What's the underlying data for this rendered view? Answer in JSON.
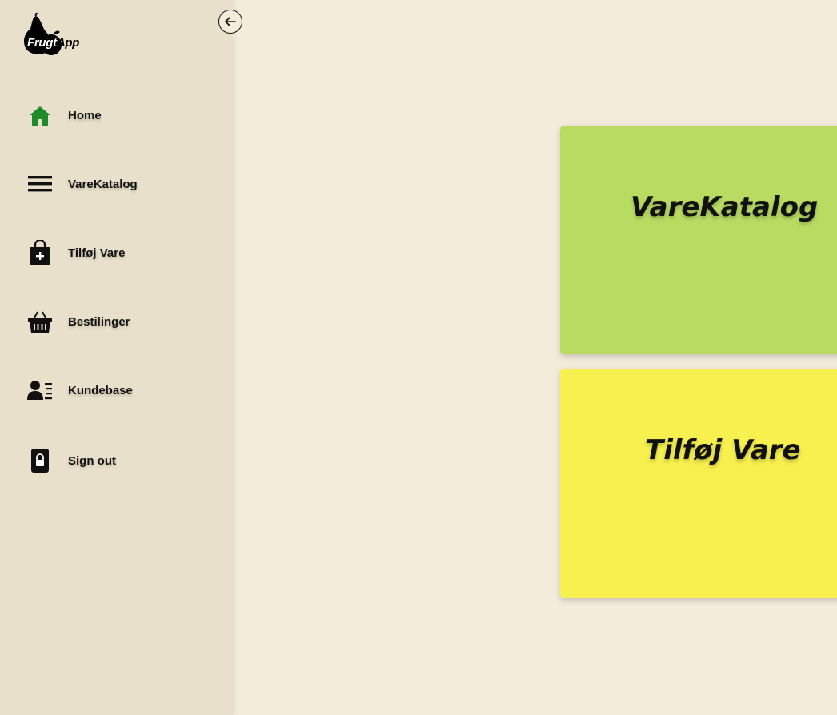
{
  "app": {
    "logo_text_1": "Frugt",
    "logo_text_2": "App"
  },
  "sidebar": {
    "items": [
      {
        "label": "Home",
        "icon": "home-icon"
      },
      {
        "label": "VareKatalog",
        "icon": "menu-lines-icon"
      },
      {
        "label": "Tilføj Vare",
        "icon": "shopping-bag-plus-icon"
      },
      {
        "label": "Bestilinger",
        "icon": "basket-icon"
      },
      {
        "label": "Kundebase",
        "icon": "contact-list-icon"
      },
      {
        "label": "Sign out",
        "icon": "lock-icon"
      }
    ]
  },
  "cards": [
    {
      "title": "VareKatalog"
    },
    {
      "title": "Tilføj Vare"
    }
  ],
  "colors": {
    "background": "#f3ecdb",
    "sidebar": "#e8e0ca",
    "card_green": "#b8dc62",
    "card_yellow": "#f7f04e",
    "home_icon": "#1e8a2a"
  }
}
